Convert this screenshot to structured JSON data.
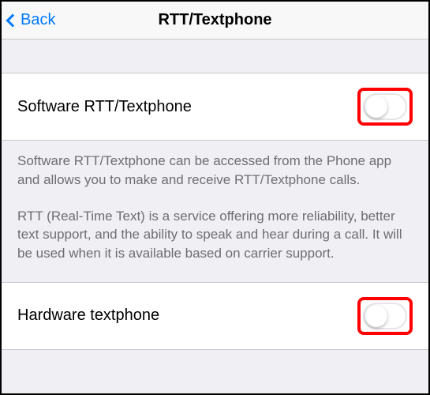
{
  "nav": {
    "back_label": "Back",
    "title": "RTT/Textphone"
  },
  "settings": {
    "software_rtt": {
      "label": "Software RTT/Textphone",
      "enabled": false
    },
    "hardware_textphone": {
      "label": "Hardware textphone",
      "enabled": false
    }
  },
  "info": {
    "para1": "Software RTT/Textphone can be accessed from the Phone app and allows you to make and receive RTT/Textphone calls.",
    "para2": "RTT (Real-Time Text) is a service offering more reliability, better text support, and the ability to speak and hear during a call. It will be used when it is available based on carrier support."
  }
}
